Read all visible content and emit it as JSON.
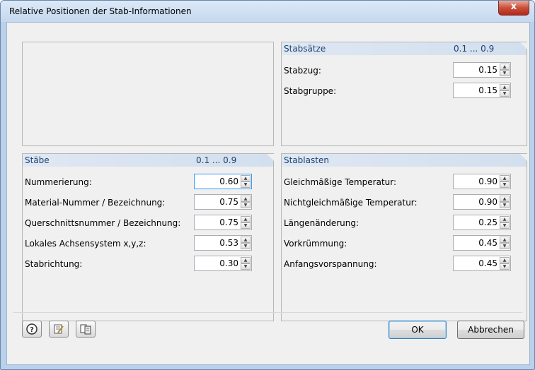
{
  "window": {
    "title": "Relative Positionen der Stab-Informationen",
    "close_label": "x"
  },
  "stabsaetze": {
    "header": "Stabsätze",
    "range": "0.1 ... 0.9",
    "rows": [
      {
        "label": "Stabzug:",
        "value": "0.15"
      },
      {
        "label": "Stabgruppe:",
        "value": "0.15"
      }
    ]
  },
  "staebe": {
    "header": "Stäbe",
    "range": "0.1 ... 0.9",
    "rows": [
      {
        "label": "Nummerierung:",
        "value": "0.60"
      },
      {
        "label": "Material-Nummer / Bezeichnung:",
        "value": "0.75"
      },
      {
        "label": "Querschnittsnummer / Bezeichnung:",
        "value": "0.75"
      },
      {
        "label": "Lokales Achsensystem x,y,z:",
        "value": "0.53"
      },
      {
        "label": "Stabrichtung:",
        "value": "0.30"
      }
    ]
  },
  "stablasten": {
    "header": "Stablasten",
    "rows": [
      {
        "label": "Gleichmäßige Temperatur:",
        "value": "0.90"
      },
      {
        "label": "Nichtgleichmäßige Temperatur:",
        "value": "0.90"
      },
      {
        "label": "Längenänderung:",
        "value": "0.25"
      },
      {
        "label": "Vorkrümmung:",
        "value": "0.45"
      },
      {
        "label": "Anfangsvorspannung:",
        "value": "0.45"
      }
    ]
  },
  "footer": {
    "icons": [
      "help-icon",
      "edit-icon",
      "copy-icon"
    ],
    "ok_label": "OK",
    "cancel_label": "Abbrechen"
  }
}
